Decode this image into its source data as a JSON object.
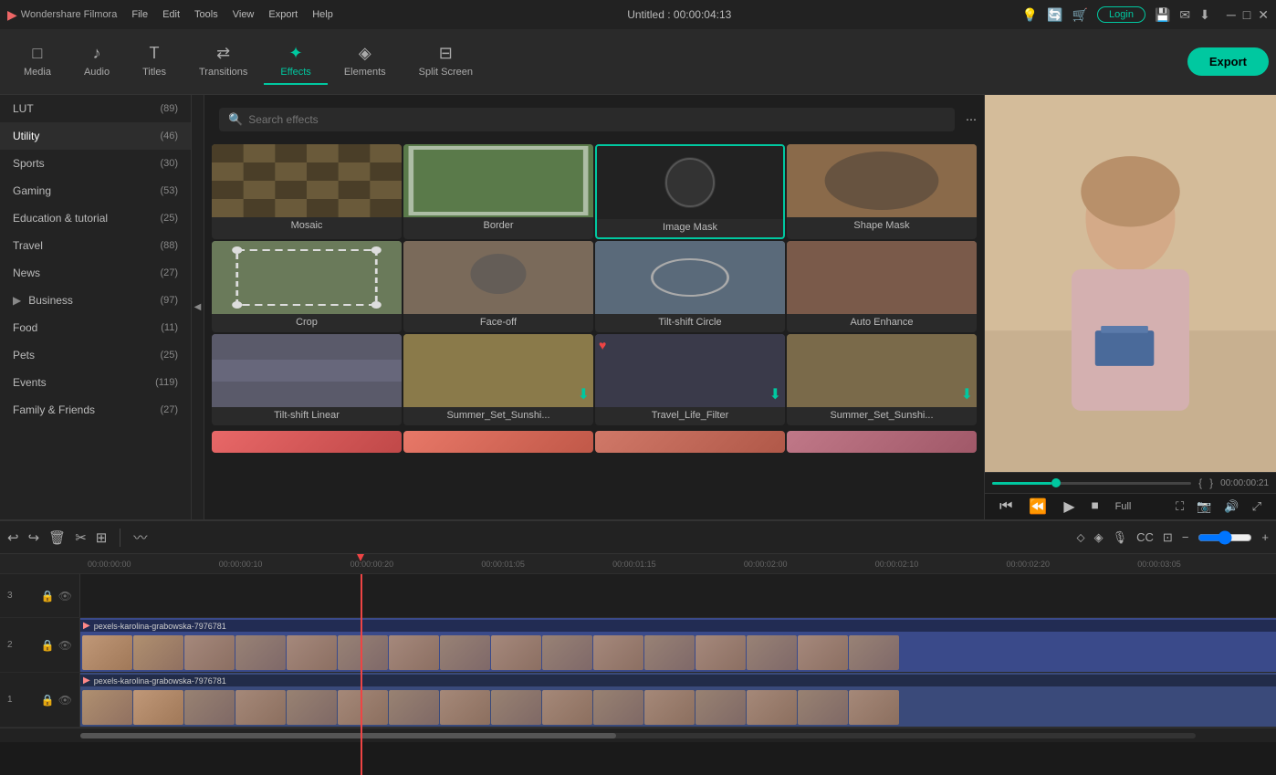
{
  "titlebar": {
    "logo_text": "Wondershare Filmora",
    "menu": [
      "File",
      "Edit",
      "Tools",
      "View",
      "Export",
      "Help"
    ],
    "title": "Untitled : 00:00:04:13",
    "login_label": "Login"
  },
  "toolbar": {
    "items": [
      {
        "id": "media",
        "label": "Media",
        "icon": "□"
      },
      {
        "id": "audio",
        "label": "Audio",
        "icon": "♪"
      },
      {
        "id": "titles",
        "label": "Titles",
        "icon": "T"
      },
      {
        "id": "transitions",
        "label": "Transitions",
        "icon": "⇄"
      },
      {
        "id": "effects",
        "label": "Effects",
        "icon": "✦"
      },
      {
        "id": "elements",
        "label": "Elements",
        "icon": "◈"
      },
      {
        "id": "splitscreen",
        "label": "Split Screen",
        "icon": "⊟"
      }
    ],
    "active": "effects",
    "export_label": "Export"
  },
  "sidebar": {
    "items": [
      {
        "id": "lut",
        "label": "LUT",
        "count": "(89)",
        "has_arrow": false
      },
      {
        "id": "utility",
        "label": "Utility",
        "count": "(46)",
        "has_arrow": false,
        "active": true
      },
      {
        "id": "sports",
        "label": "Sports",
        "count": "(30)",
        "has_arrow": false
      },
      {
        "id": "gaming",
        "label": "Gaming",
        "count": "(53)",
        "has_arrow": false
      },
      {
        "id": "education",
        "label": "Education & tutorial",
        "count": "(25)",
        "has_arrow": false
      },
      {
        "id": "travel",
        "label": "Travel",
        "count": "(88)",
        "has_arrow": false
      },
      {
        "id": "news",
        "label": "News",
        "count": "(27)",
        "has_arrow": false
      },
      {
        "id": "business",
        "label": "Business",
        "count": "(97)",
        "has_arrow": true
      },
      {
        "id": "food",
        "label": "Food",
        "count": "(11)",
        "has_arrow": false
      },
      {
        "id": "pets",
        "label": "Pets",
        "count": "(25)",
        "has_arrow": false
      },
      {
        "id": "events",
        "label": "Events",
        "count": "(119)",
        "has_arrow": false
      },
      {
        "id": "familyfriends",
        "label": "Family & Friends",
        "count": "(27)",
        "has_arrow": false
      }
    ]
  },
  "search": {
    "placeholder": "Search effects"
  },
  "effects_grid": {
    "items": [
      {
        "id": "mosaic",
        "label": "Mosaic",
        "selected": false,
        "thumb_class": "thumb-mosaic",
        "has_dl": false
      },
      {
        "id": "border",
        "label": "Border",
        "selected": false,
        "thumb_class": "thumb-border",
        "has_dl": false
      },
      {
        "id": "imagemask",
        "label": "Image Mask",
        "selected": true,
        "thumb_class": "thumb-imagemask",
        "has_dl": false
      },
      {
        "id": "shapemask",
        "label": "Shape Mask",
        "selected": false,
        "thumb_class": "thumb-shapemask",
        "has_dl": false
      },
      {
        "id": "crop",
        "label": "Crop",
        "selected": false,
        "thumb_class": "thumb-crop",
        "has_dl": false
      },
      {
        "id": "faceoff",
        "label": "Face-off",
        "selected": false,
        "thumb_class": "thumb-faceoff",
        "has_dl": false
      },
      {
        "id": "tiltcircle",
        "label": "Tilt-shift Circle",
        "selected": false,
        "thumb_class": "thumb-tiltcircle",
        "has_dl": false
      },
      {
        "id": "autoenhance",
        "label": "Auto Enhance",
        "selected": false,
        "thumb_class": "thumb-autoenhance",
        "has_dl": false
      },
      {
        "id": "tiltlinear",
        "label": "Tilt-shift Linear",
        "selected": false,
        "thumb_class": "thumb-tiltlinear",
        "has_dl": false
      },
      {
        "id": "summerset",
        "label": "Summer_Set_Sunshi...",
        "selected": false,
        "thumb_class": "thumb-summerset",
        "has_dl": true
      },
      {
        "id": "travellife",
        "label": "Travel_Life_Filter",
        "selected": false,
        "thumb_class": "thumb-travellife",
        "has_dl": true,
        "has_heart": true
      },
      {
        "id": "summerset2",
        "label": "Summer_Set_Sunshi...",
        "selected": false,
        "thumb_class": "thumb-summerset2",
        "has_dl": true
      }
    ]
  },
  "preview": {
    "timecode": "00:00:00:21",
    "zoom_label": "Full",
    "progress_pct": 30,
    "in_point": "{",
    "out_point": "}"
  },
  "timeline": {
    "ruler_marks": [
      "00:00:00:00",
      "00:00:00:10",
      "00:00:00:20",
      "00:00:01:05",
      "00:00:01:15",
      "00:00:02:00",
      "00:00:02:10",
      "00:00:02:20",
      "00:00:03:05"
    ],
    "tracks": [
      {
        "id": "track3",
        "label": "3",
        "type": "empty"
      },
      {
        "id": "track2",
        "label": "2",
        "type": "video",
        "clip_name": "pexels-karolina-grabowska-7976781"
      },
      {
        "id": "track1",
        "label": "1",
        "type": "video",
        "clip_name": "pexels-karolina-grabowska-7976781"
      }
    ]
  }
}
